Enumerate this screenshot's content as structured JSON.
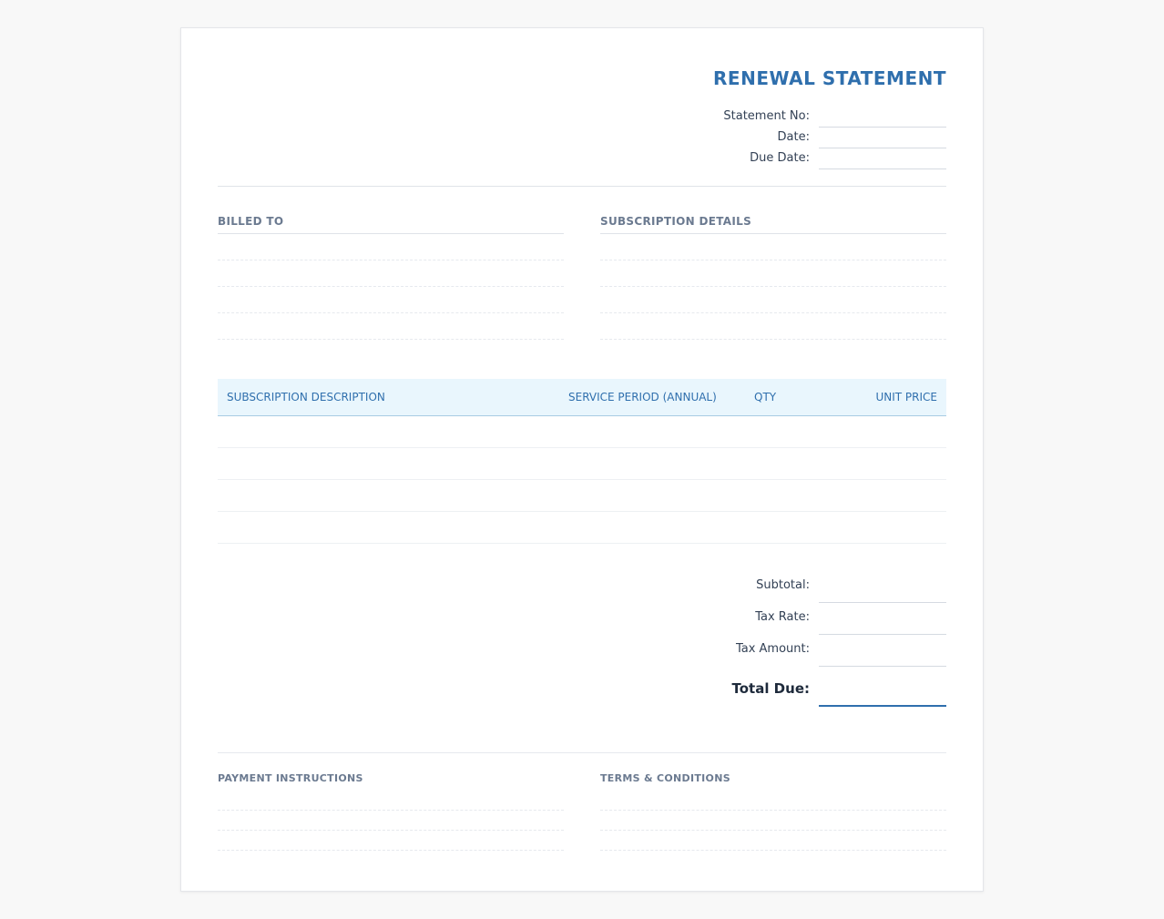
{
  "document": {
    "title": "RENEWAL STATEMENT",
    "meta": [
      {
        "label": "Statement No:",
        "value": ""
      },
      {
        "label": "Date:",
        "value": ""
      },
      {
        "label": "Due Date:",
        "value": ""
      }
    ]
  },
  "billed_to": {
    "heading": "BILLED TO",
    "lines": [
      "",
      "",
      "",
      ""
    ]
  },
  "subscription_details": {
    "heading": "SUBSCRIPTION DETAILS",
    "lines": [
      "",
      "",
      "",
      ""
    ]
  },
  "table": {
    "columns": [
      "SUBSCRIPTION DESCRIPTION",
      "SERVICE PERIOD (ANNUAL)",
      "QTY",
      "UNIT PRICE"
    ],
    "rows": [
      [
        "",
        "",
        "",
        ""
      ],
      [
        "",
        "",
        "",
        ""
      ],
      [
        "",
        "",
        "",
        ""
      ],
      [
        "",
        "",
        "",
        ""
      ]
    ]
  },
  "totals": {
    "subtotal_label": "Subtotal:",
    "tax_rate_label": "Tax Rate:",
    "tax_amount_label": "Tax Amount:",
    "total_due_label": "Total Due:"
  },
  "footer": {
    "payment_heading": "PAYMENT INSTRUCTIONS",
    "terms_heading": "TERMS & CONDITIONS"
  },
  "colors": {
    "accent": "#2f6fad",
    "table_header_bg": "#e9f6fd"
  }
}
